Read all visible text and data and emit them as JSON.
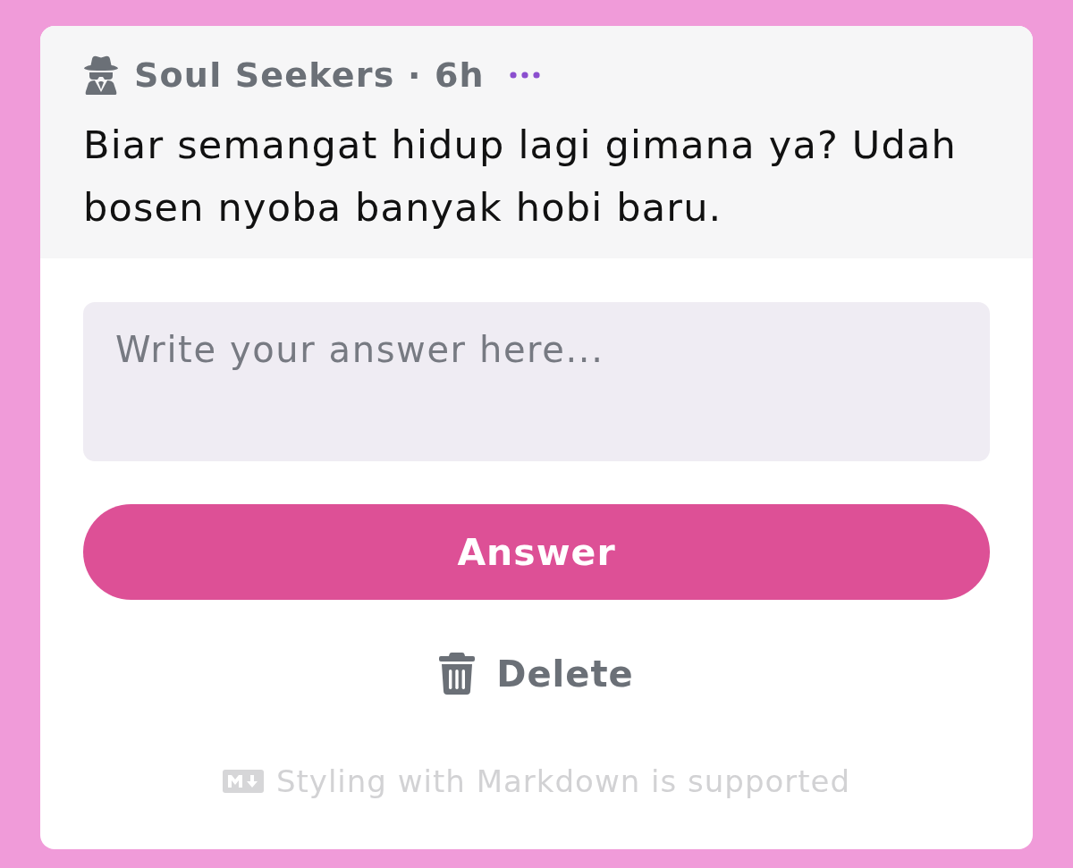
{
  "post": {
    "byline": "Soul Seekers · 6h",
    "question": "Biar semangat hidup lagi gimana ya? Udah bosen nyoba banyak hobi baru."
  },
  "answer_field": {
    "placeholder": "Write your answer here..."
  },
  "answer_button": {
    "label": "Answer"
  },
  "delete_button": {
    "label": "Delete"
  },
  "footer_note": "Styling with Markdown is supported"
}
